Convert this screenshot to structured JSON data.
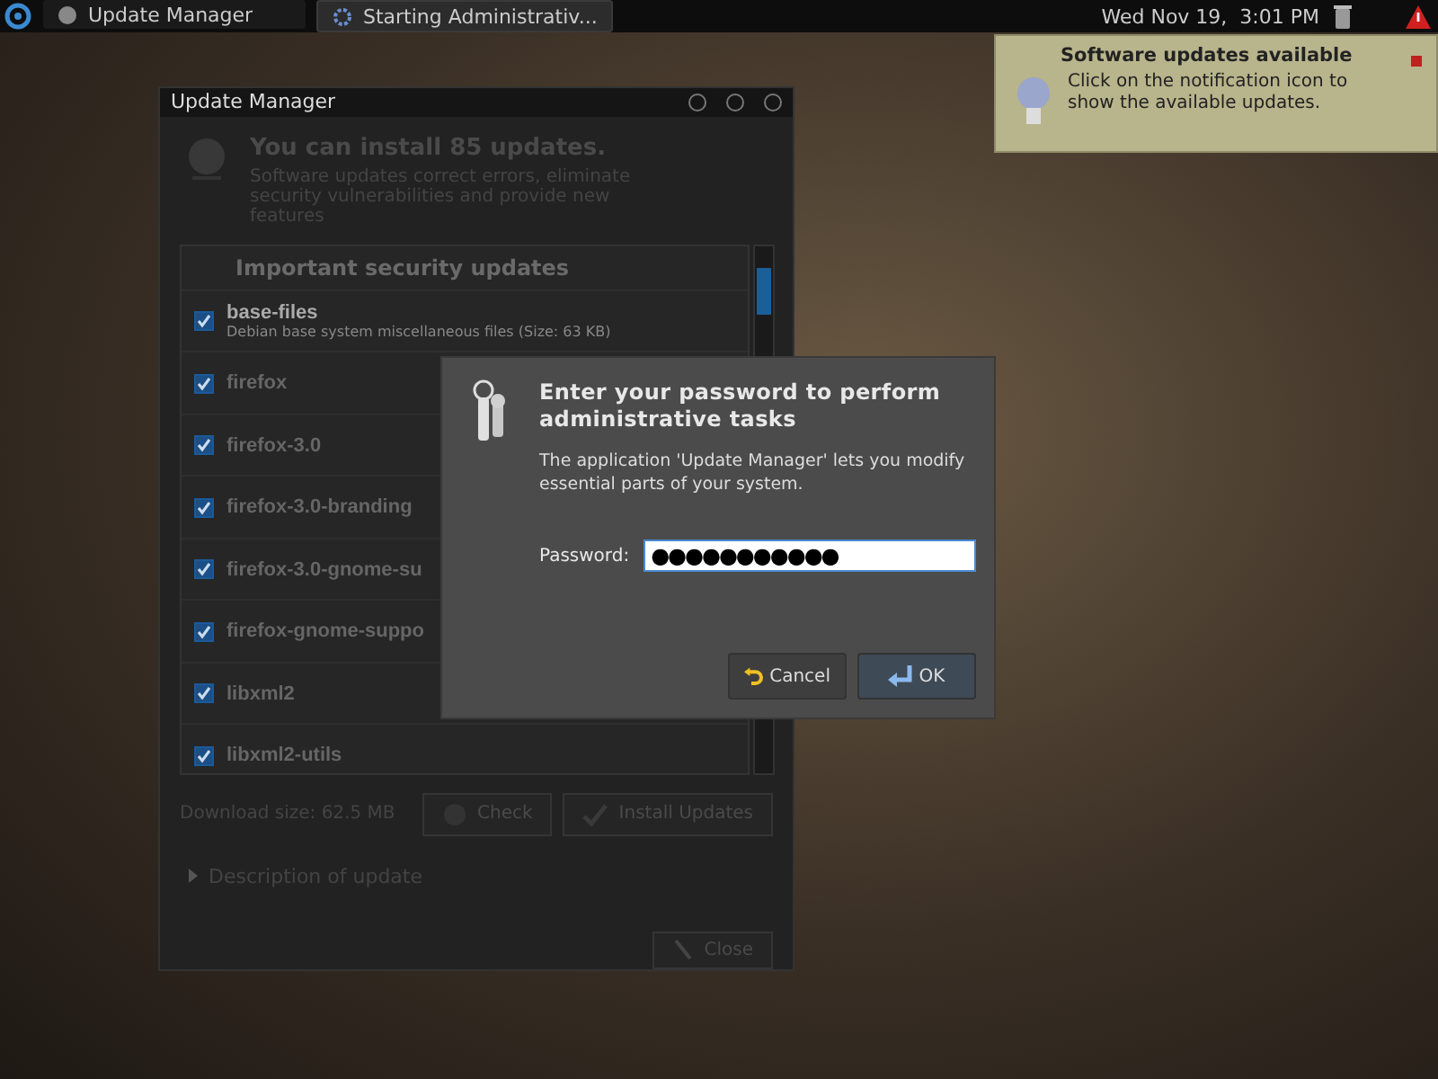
{
  "panel": {
    "tasks": [
      {
        "label": "Update Manager",
        "selected": false
      },
      {
        "label": "Starting Administrativ...",
        "selected": true
      }
    ],
    "clock": "Wed Nov 19,  3:01 PM"
  },
  "update_manager": {
    "title": "Update Manager",
    "heading": "You can install 85 updates.",
    "subheading": "Software updates correct errors, eliminate security vulnerabilities and provide new features",
    "section": "Important security updates",
    "packages": [
      {
        "name": "base-files",
        "description": "Debian base system miscellaneous files (Size: 63 KB)",
        "checked": true
      },
      {
        "name": "firefox",
        "checked": true
      },
      {
        "name": "firefox-3.0",
        "checked": true
      },
      {
        "name": "firefox-3.0-branding",
        "checked": true
      },
      {
        "name": "firefox-3.0-gnome-su",
        "checked": true
      },
      {
        "name": "firefox-gnome-suppo",
        "checked": true
      },
      {
        "name": "libxml2",
        "checked": true
      },
      {
        "name": "libxml2-utils",
        "checked": true
      }
    ],
    "download_size": "Download size: 62.5 MB",
    "actions": [
      {
        "label": "Check",
        "kind": "check"
      },
      {
        "label": "Install Updates",
        "kind": "install"
      }
    ],
    "expander": {
      "label": "Description of update",
      "expanded": false
    },
    "close": "Close"
  },
  "dialog": {
    "heading": "Enter your password to perform administrative tasks",
    "message": "The application 'Update Manager' lets you modify essential parts of your system.",
    "password_label": "Password:",
    "password": "●●●●●●●●●●●",
    "buttons": [
      {
        "label": "Cancel",
        "kind": "cancel"
      },
      {
        "label": "OK",
        "kind": "ok"
      }
    ]
  },
  "notification": {
    "title": "Software updates available",
    "body": "Click on the notification icon to show the available updates."
  }
}
